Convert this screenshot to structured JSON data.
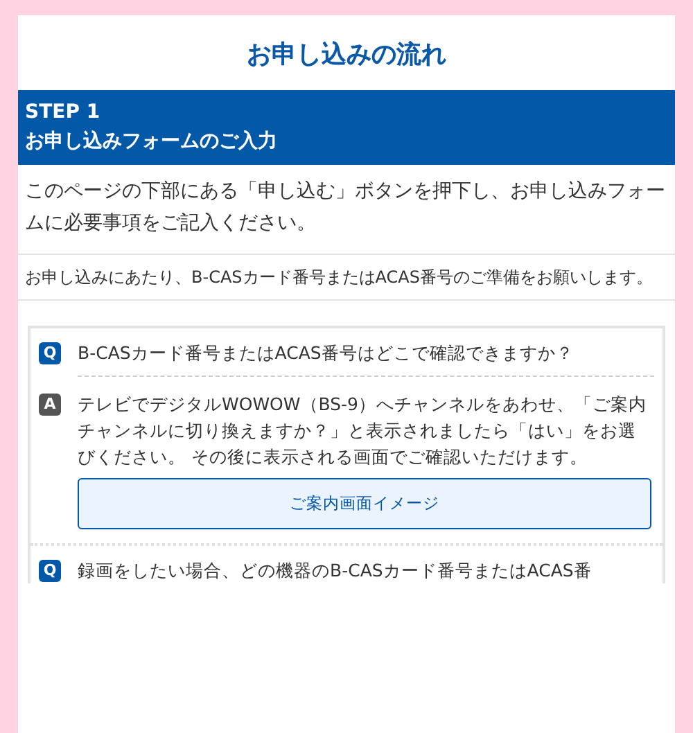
{
  "title": "お申し込みの流れ",
  "step": {
    "label": "STEP 1",
    "heading": "お申し込みフォームのご入力"
  },
  "notes": [
    {
      "kind": "lead",
      "text": "このページの下部にある「申し込む」ボタンを押下し、お申し込みフォームに必要事項をご記入ください。"
    },
    {
      "kind": "small",
      "text": "お申し込みにあたり、B-CASカード番号またはACAS番号のご準備をお願いします。"
    }
  ],
  "faq": [
    {
      "q_mark": "Q",
      "question": "B-CASカード番号またはACAS番号はどこで確認できますか？",
      "a_mark": "A",
      "answer": "テレビでデジタルWOWOW（BS-9）へチャンネルをあわせ、「ご案内チャンネルに切り換えますか？」と表示されましたら「はい」をお選びください。 その後に表示される画面でご確認いただけます。",
      "button": "ご案内画面イメージ"
    },
    {
      "q_mark": "Q",
      "question": "録画をしたい場合、どの機器のB-CASカード番号またはACAS番"
    }
  ]
}
